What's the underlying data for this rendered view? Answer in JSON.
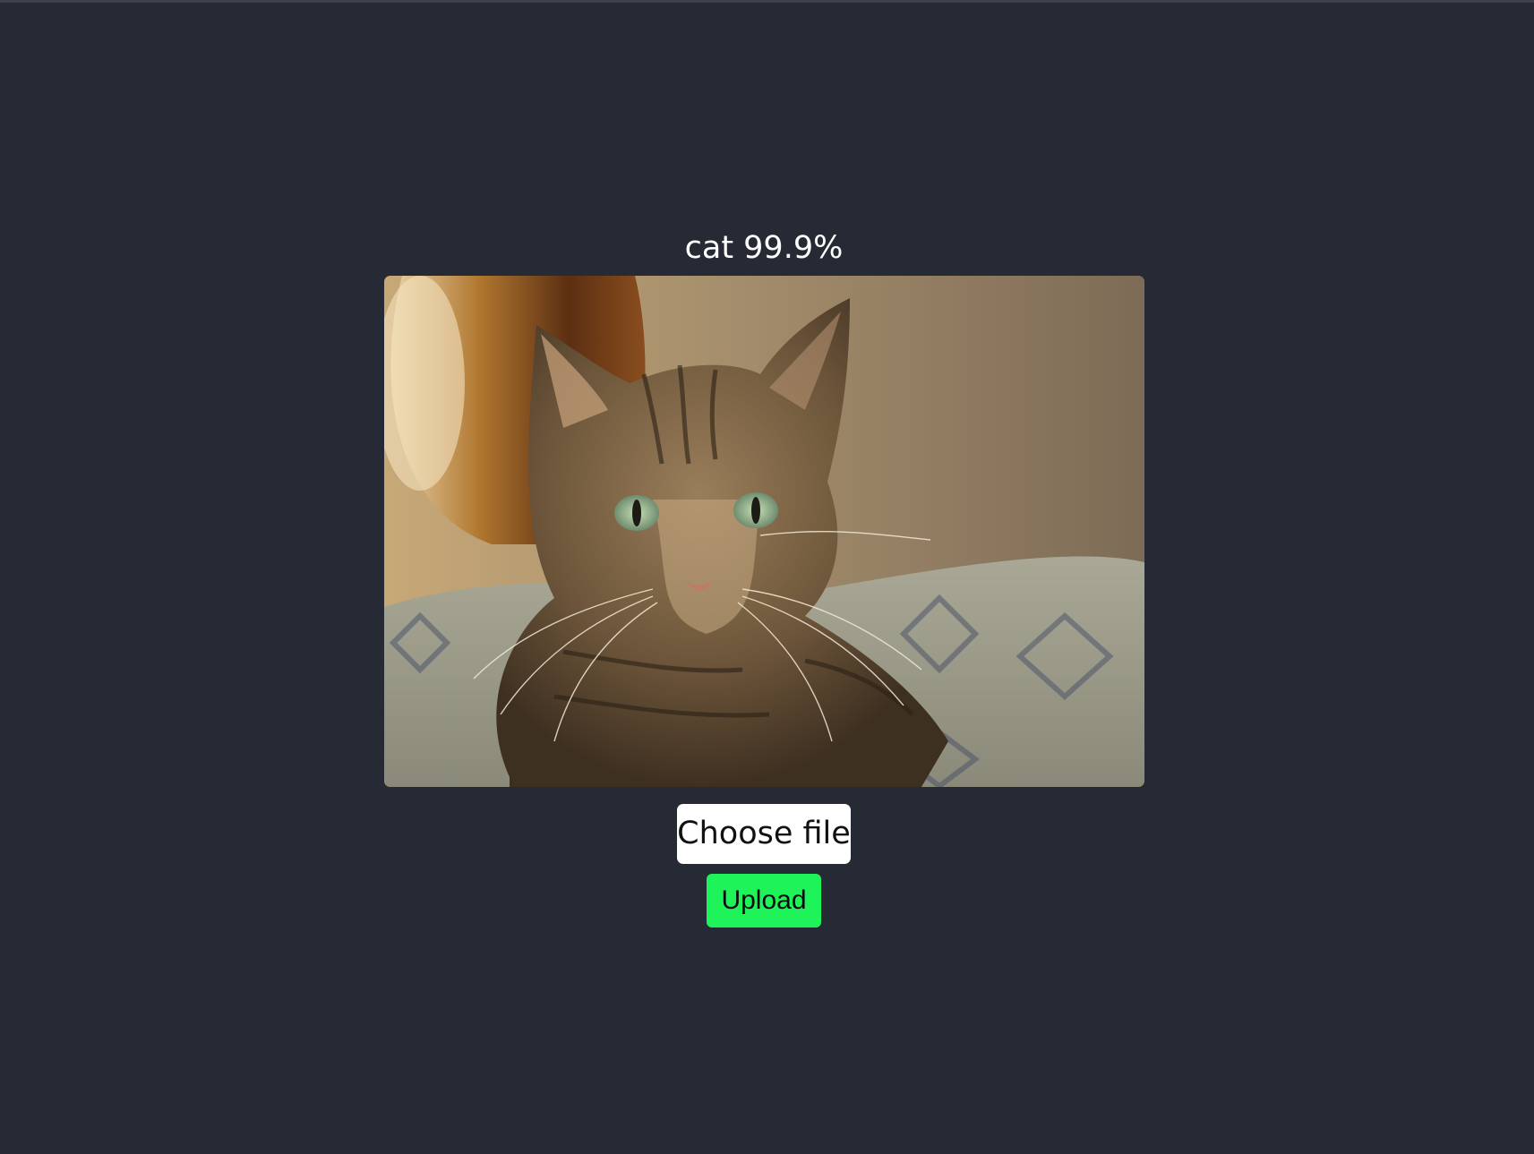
{
  "prediction": {
    "text": "cat 99.9%",
    "label": "cat",
    "confidence_percent": 99.9
  },
  "image": {
    "description_icon": "uploaded-image",
    "alt": ""
  },
  "controls": {
    "choose_file_label": "Choose file",
    "upload_label": "Upload"
  },
  "colors": {
    "background": "#262a34",
    "upload_button": "#1ef35a",
    "choose_button": "#ffffff",
    "text": "#ffffff"
  }
}
